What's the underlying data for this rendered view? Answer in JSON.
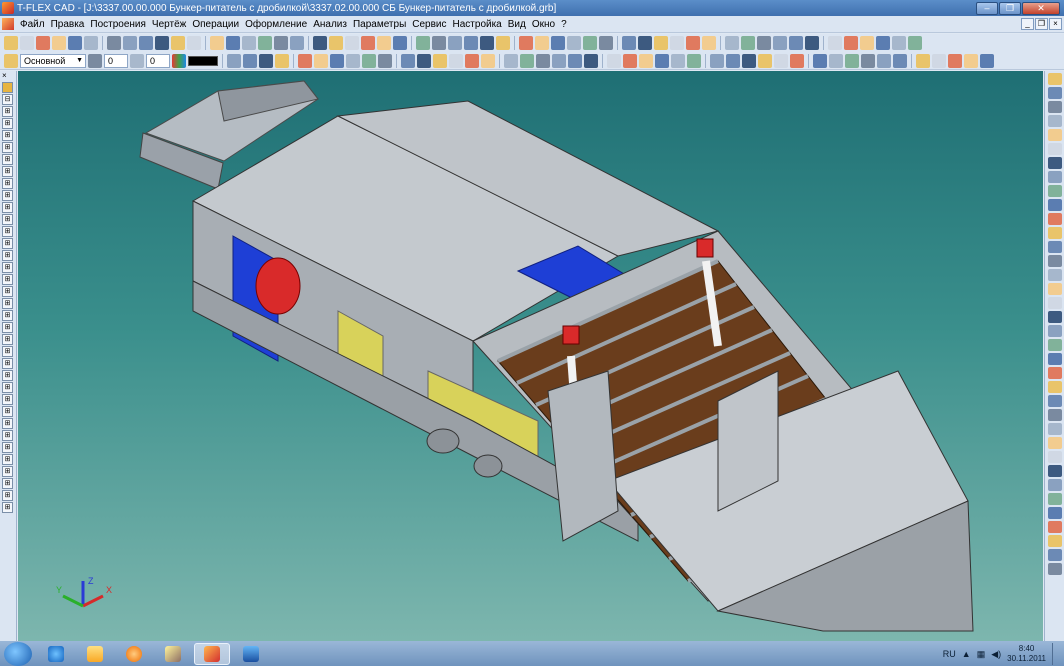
{
  "window": {
    "title": "T-FLEX CAD - [J:\\3337.00.00.000 Бункер-питатель с дробилкой\\3337.02.00.000 СБ Бункер-питатель с дробилкой.grb]"
  },
  "menu": {
    "items": [
      "Файл",
      "Правка",
      "Построения",
      "Чертёж",
      "Операции",
      "Оформление",
      "Анализ",
      "Параметры",
      "Сервис",
      "Настройка",
      "Вид",
      "Окно",
      "?"
    ]
  },
  "toolbar": {
    "layer_value": "Основной",
    "level_value": "0",
    "priority_value": "0",
    "color_value": "#000000"
  },
  "axis": {
    "x": "X",
    "y": "Y",
    "z": "Z"
  },
  "tray": {
    "language": "RU",
    "time": "8:40",
    "date": "30.11.2011"
  },
  "colors": {
    "model_gray": "#b9bec4",
    "model_blue": "#1e3fd6",
    "model_yellow": "#d8d25a",
    "model_red": "#d92a2a",
    "model_brown": "#6a3d1c",
    "viewport_bg": "#2e7f80"
  },
  "icons": [
    "start-orb",
    "ie-icon",
    "explorer-icon",
    "media-player-icon",
    "app-pen-icon",
    "tflex-icon",
    "word-icon"
  ]
}
